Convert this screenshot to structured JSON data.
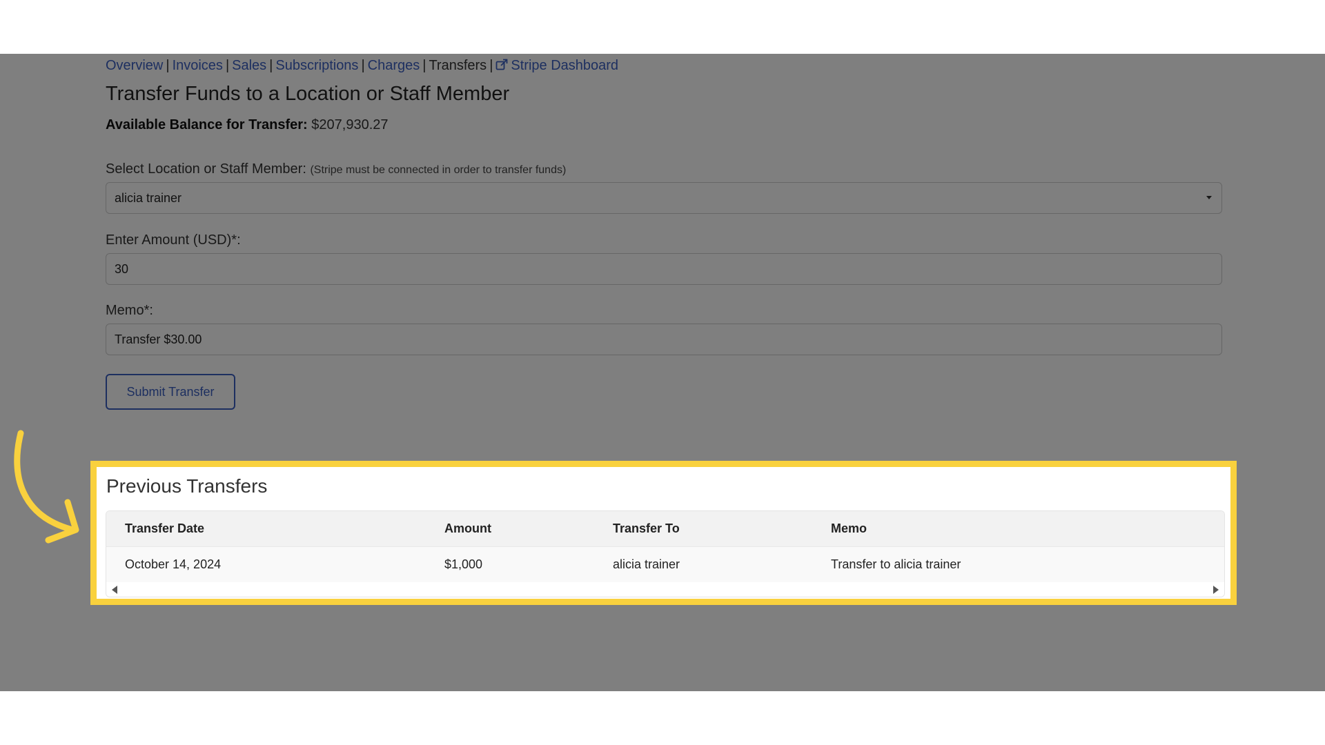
{
  "nav": {
    "items": [
      {
        "label": "Overview"
      },
      {
        "label": "Invoices"
      },
      {
        "label": "Sales"
      },
      {
        "label": "Subscriptions"
      },
      {
        "label": "Charges"
      },
      {
        "label": "Transfers"
      },
      {
        "label": "Stripe Dashboard",
        "icon": "external-link-icon"
      }
    ],
    "separator": "|"
  },
  "page": {
    "title": "Transfer Funds to a Location or Staff Member",
    "balance_label": "Available Balance for Transfer:",
    "balance_value": "$207,930.27"
  },
  "form": {
    "select_label": "Select Location or Staff Member:",
    "select_hint": "(Stripe must be connected in order to transfer funds)",
    "select_value": "alicia trainer",
    "amount_label": "Enter Amount (USD)*:",
    "amount_value": "30",
    "memo_label": "Memo*:",
    "memo_value": "Transfer $30.00",
    "submit_label": "Submit Transfer"
  },
  "previous_transfers": {
    "title": "Previous Transfers",
    "columns": [
      "Transfer Date",
      "Amount",
      "Transfer To",
      "Memo"
    ],
    "rows": [
      [
        "October 14, 2024",
        "$1,000",
        "alicia trainer",
        "Transfer to alicia trainer"
      ]
    ]
  },
  "colors": {
    "link": "#3b5fc0",
    "highlight": "#f9d13e",
    "overlay": "rgba(0,0,0,0.5)"
  }
}
